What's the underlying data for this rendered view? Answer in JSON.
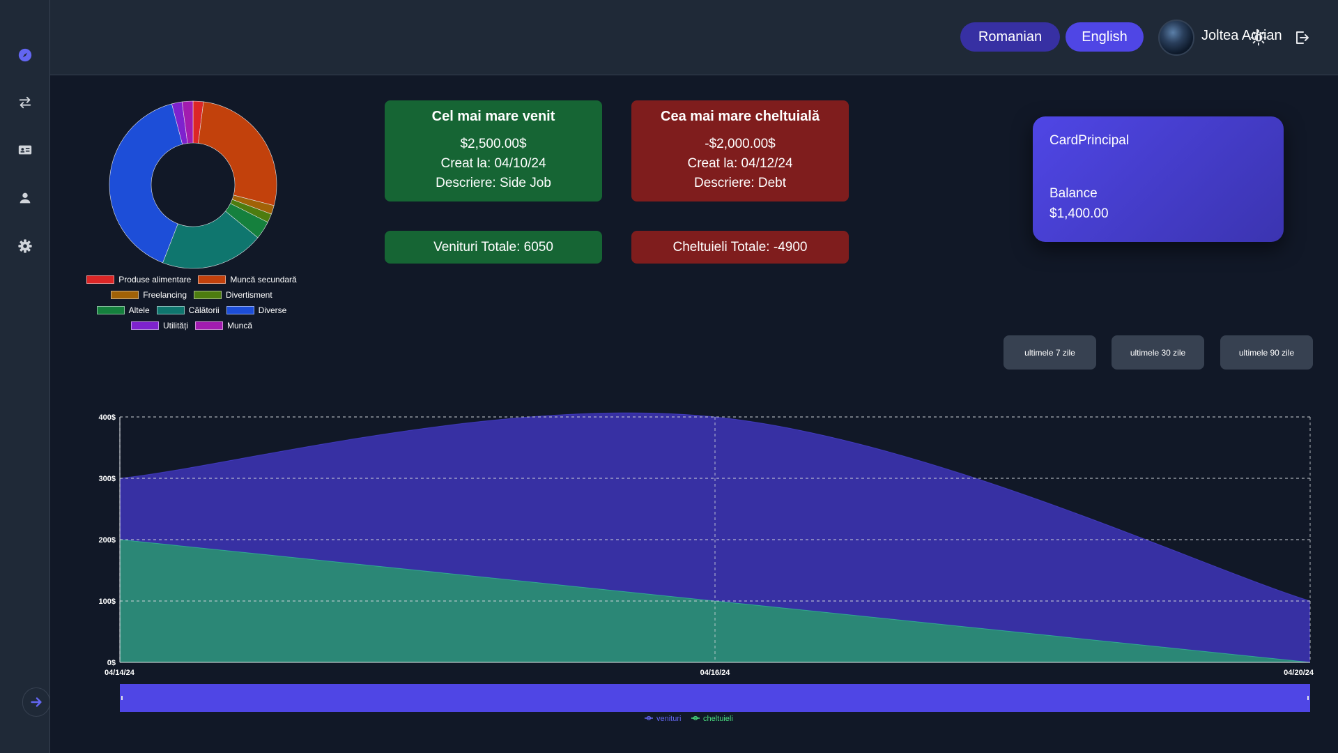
{
  "sidebar": {
    "items": [
      {
        "icon": "compass-icon",
        "active": true
      },
      {
        "icon": "transfer-arrows-icon"
      },
      {
        "icon": "id-card-icon"
      },
      {
        "icon": "user-icon"
      },
      {
        "icon": "gear-icon"
      }
    ],
    "expand_icon": "arrow-right-icon"
  },
  "header": {
    "lang_ro": "Romanian",
    "lang_en": "English",
    "user_name": "Joltea Adrian",
    "theme_icon": "sun-icon",
    "logout_icon": "logout-icon"
  },
  "highest_income": {
    "title": "Cel mai mare venit",
    "amount": "$2,500.00$",
    "created": "Creat la: 04/10/24",
    "description": "Descriere: Side Job"
  },
  "highest_expense": {
    "title": "Cea mai mare cheltuială",
    "amount": "-$2,000.00$",
    "created": "Creat la: 04/12/24",
    "description": "Descriere: Debt"
  },
  "totals": {
    "income": "Venituri Totale: 6050",
    "expense": "Cheltuieli Totale: -4900"
  },
  "card": {
    "name": "CardPrincipal",
    "balance_label": "Balance",
    "balance_value": "$1,400.00"
  },
  "range_buttons": [
    "ultimele 7 zile",
    "ultimele 30 zile",
    "ultimele 90 zile"
  ],
  "colors": {
    "accent": "#4f46e5",
    "income_card": "#166534",
    "expense_card": "#7f1d1d",
    "income_area": "#3730a3",
    "expense_area": "#2a8c74"
  },
  "donut_chart": {
    "type": "pie",
    "slices": [
      {
        "label": "Produse alimentare",
        "value": 2.0,
        "color": "#dc2626"
      },
      {
        "label": "Muncă secundară",
        "value": 27.0,
        "color": "#c2410c"
      },
      {
        "label": "Freelancing",
        "value": 1.7,
        "color": "#a16207"
      },
      {
        "label": "Divertisment",
        "value": 1.7,
        "color": "#4d7c0f"
      },
      {
        "label": "Altele",
        "value": 3.5,
        "color": "#15803d"
      },
      {
        "label": "Călătorii",
        "value": 20.0,
        "color": "#0f766e"
      },
      {
        "label": "Diverse",
        "value": 40.0,
        "color": "#1d4ed8"
      },
      {
        "label": "Utilități",
        "value": 2.0,
        "color": "#7e22ce"
      },
      {
        "label": "Muncă",
        "value": 2.1,
        "color": "#a21caf"
      }
    ],
    "legend_rows": [
      [
        0,
        1
      ],
      [
        2,
        3
      ],
      [
        4,
        5,
        6
      ],
      [
        7,
        8
      ]
    ]
  },
  "chart_data": {
    "type": "area",
    "x": [
      "04/14/24",
      "04/16/24",
      "04/20/24"
    ],
    "series": [
      {
        "name": "venituri",
        "values": [
          300,
          400,
          100
        ],
        "color": "#3730a3"
      },
      {
        "name": "cheltuieli",
        "values": [
          200,
          100,
          0
        ],
        "color": "#2a8c74"
      }
    ],
    "ylim": [
      0,
      400
    ],
    "yticks": [
      "0$",
      "100$",
      "200$",
      "300$",
      "400$"
    ],
    "grid": true,
    "legend_placement": "bottom"
  }
}
